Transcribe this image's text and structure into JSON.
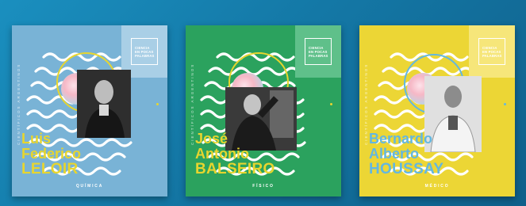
{
  "cards": [
    {
      "first": "Luis",
      "middle": "Federico",
      "last": "LELOIR",
      "discipline": "QUÍMICA",
      "bg": "#79b3d6",
      "tab": "#a9cfe6",
      "accent": "#e7d52e"
    },
    {
      "first": "José",
      "middle": "Antonio",
      "last": "BALSEIRO",
      "discipline": "FÍSICO",
      "bg": "#2ba25e",
      "tab": "#5fc08a",
      "accent": "#e7d52e"
    },
    {
      "first": "Bernardo",
      "middle": "Alberto",
      "last": "HOUSSAY",
      "discipline": "MÉDICO",
      "bg": "#ecd635",
      "tab": "#f6e67a",
      "accent": "#63b7e0"
    }
  ],
  "logo": {
    "line1": "CIENCIA",
    "line2": "EN POCAS",
    "line3": "PALABRAS"
  },
  "vertical_text": "CIENTÍFICOS ARGENTINOS"
}
